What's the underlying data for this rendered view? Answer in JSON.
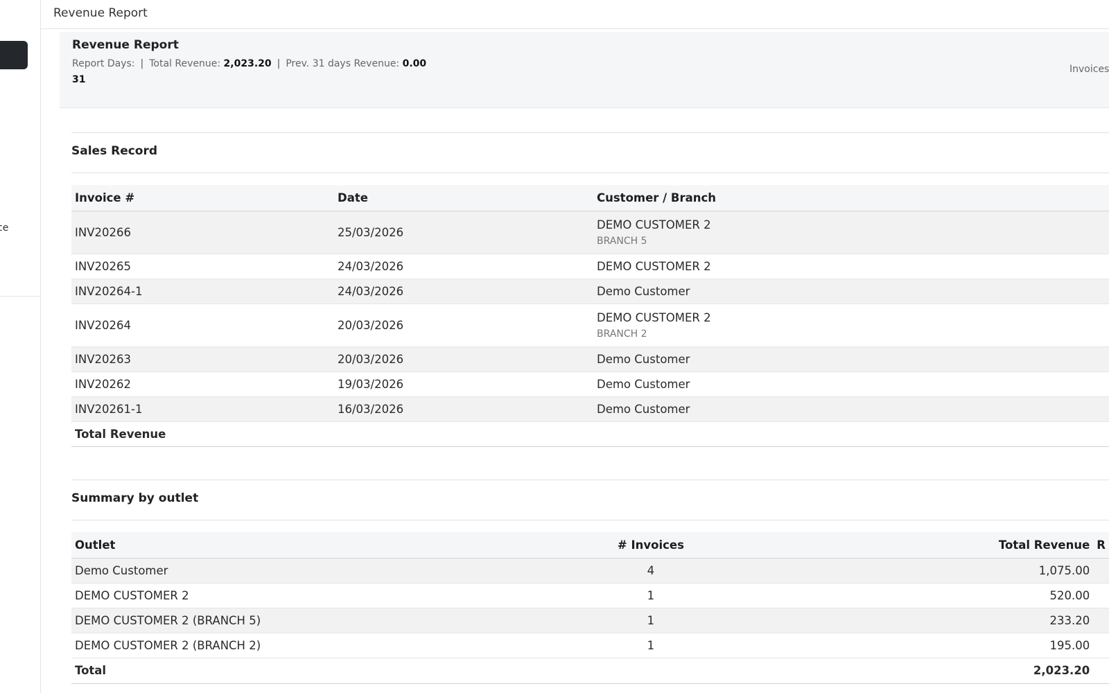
{
  "topbar": {
    "title": "Revenue Report"
  },
  "sidebar": {
    "cut_label": "ce"
  },
  "header": {
    "title": "Revenue Report",
    "report_days_label": "Report Days:",
    "report_days_value": "31",
    "total_revenue_label": "Total Revenue:",
    "total_revenue_value": "2,023.20",
    "prev_label": "Prev. 31 days Revenue:",
    "prev_value": "0.00",
    "separator": "|",
    "right_label": "Invoices"
  },
  "sales": {
    "title": "Sales Record",
    "columns": [
      "Invoice #",
      "Date",
      "Customer / Branch"
    ],
    "rows": [
      {
        "invoice": "INV20266",
        "date": "25/03/2026",
        "customer": "DEMO CUSTOMER 2",
        "branch": "BRANCH 5"
      },
      {
        "invoice": "INV20265",
        "date": "24/03/2026",
        "customer": "DEMO CUSTOMER 2",
        "branch": ""
      },
      {
        "invoice": "INV20264-1",
        "date": "24/03/2026",
        "customer": "Demo Customer",
        "branch": ""
      },
      {
        "invoice": "INV20264",
        "date": "20/03/2026",
        "customer": "DEMO CUSTOMER 2",
        "branch": "BRANCH 2"
      },
      {
        "invoice": "INV20263",
        "date": "20/03/2026",
        "customer": "Demo Customer",
        "branch": ""
      },
      {
        "invoice": "INV20262",
        "date": "19/03/2026",
        "customer": "Demo Customer",
        "branch": ""
      },
      {
        "invoice": "INV20261-1",
        "date": "16/03/2026",
        "customer": "Demo Customer",
        "branch": ""
      }
    ],
    "footer_label": "Total Revenue"
  },
  "outlet": {
    "title": "Summary by outlet",
    "columns": [
      "Outlet",
      "# Invoices",
      "Total Revenue",
      "R"
    ],
    "rows": [
      {
        "outlet": "Demo Customer",
        "invoices": "4",
        "revenue": "1,075.00"
      },
      {
        "outlet": "DEMO CUSTOMER 2",
        "invoices": "1",
        "revenue": "520.00"
      },
      {
        "outlet": "DEMO CUSTOMER 2 (BRANCH 5)",
        "invoices": "1",
        "revenue": "233.20"
      },
      {
        "outlet": "DEMO CUSTOMER 2 (BRANCH 2)",
        "invoices": "1",
        "revenue": "195.00"
      }
    ],
    "footer_label": "Total",
    "footer_revenue": "2,023.20"
  }
}
